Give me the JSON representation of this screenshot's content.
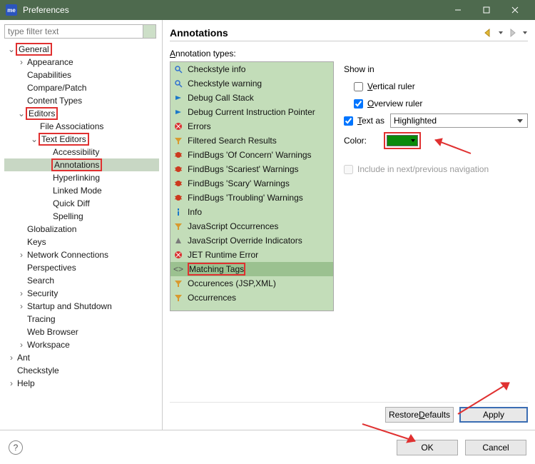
{
  "window": {
    "title": "Preferences",
    "app_icon_text": "me"
  },
  "filter": {
    "placeholder": "type filter text"
  },
  "tree": [
    {
      "label": "General",
      "depth": 0,
      "expanded": true,
      "hasChildren": true,
      "red": true
    },
    {
      "label": "Appearance",
      "depth": 1,
      "hasChildren": true
    },
    {
      "label": "Capabilities",
      "depth": 1
    },
    {
      "label": "Compare/Patch",
      "depth": 1
    },
    {
      "label": "Content Types",
      "depth": 1
    },
    {
      "label": "Editors",
      "depth": 1,
      "expanded": true,
      "hasChildren": true,
      "red": true
    },
    {
      "label": "File Associations",
      "depth": 2
    },
    {
      "label": "Text Editors",
      "depth": 2,
      "expanded": true,
      "hasChildren": true,
      "red": true
    },
    {
      "label": "Accessibility",
      "depth": 3
    },
    {
      "label": "Annotations",
      "depth": 3,
      "selected": true,
      "red": true
    },
    {
      "label": "Hyperlinking",
      "depth": 3
    },
    {
      "label": "Linked Mode",
      "depth": 3
    },
    {
      "label": "Quick Diff",
      "depth": 3
    },
    {
      "label": "Spelling",
      "depth": 3
    },
    {
      "label": "Globalization",
      "depth": 1
    },
    {
      "label": "Keys",
      "depth": 1
    },
    {
      "label": "Network Connections",
      "depth": 1,
      "hasChildren": true
    },
    {
      "label": "Perspectives",
      "depth": 1
    },
    {
      "label": "Search",
      "depth": 1
    },
    {
      "label": "Security",
      "depth": 1,
      "hasChildren": true
    },
    {
      "label": "Startup and Shutdown",
      "depth": 1,
      "hasChildren": true
    },
    {
      "label": "Tracing",
      "depth": 1
    },
    {
      "label": "Web Browser",
      "depth": 1
    },
    {
      "label": "Workspace",
      "depth": 1,
      "hasChildren": true
    },
    {
      "label": "Ant",
      "depth": 0,
      "hasChildren": true
    },
    {
      "label": "Checkstyle",
      "depth": 0
    },
    {
      "label": "Help",
      "depth": 0,
      "hasChildren": true
    }
  ],
  "page": {
    "title": "Annotations",
    "types_label": "Annotation types:",
    "items": [
      {
        "label": "Checkstyle info",
        "icon": "search",
        "color": "#2f6fd0"
      },
      {
        "label": "Checkstyle warning",
        "icon": "search",
        "color": "#2f6fd0"
      },
      {
        "label": "Debug Call Stack",
        "icon": "arrow",
        "color": "#1b78c9"
      },
      {
        "label": "Debug Current Instruction Pointer",
        "icon": "arrow",
        "color": "#1b78c9"
      },
      {
        "label": "Errors",
        "icon": "error",
        "color": "#d82f2f"
      },
      {
        "label": "Filtered Search Results",
        "icon": "filter",
        "color": "#d89a2f"
      },
      {
        "label": "FindBugs 'Of Concern' Warnings",
        "icon": "bug",
        "color": "#cc3a1e"
      },
      {
        "label": "FindBugs 'Scariest' Warnings",
        "icon": "bug",
        "color": "#cc3a1e"
      },
      {
        "label": "FindBugs 'Scary' Warnings",
        "icon": "bug",
        "color": "#cc3a1e"
      },
      {
        "label": "FindBugs 'Troubling' Warnings",
        "icon": "bug",
        "color": "#cc3a1e"
      },
      {
        "label": "Info",
        "icon": "info",
        "color": "#1b78c9"
      },
      {
        "label": "JavaScript Occurrences",
        "icon": "filter",
        "color": "#d89a2f"
      },
      {
        "label": "JavaScript Override Indicators",
        "icon": "tri",
        "color": "#7a7a7a"
      },
      {
        "label": "JET Runtime Error",
        "icon": "error",
        "color": "#d82f2f"
      },
      {
        "label": "Matching Tags",
        "icon": "tags",
        "color": "#555",
        "selected": true,
        "red": true
      },
      {
        "label": "Occurences (JSP,XML)",
        "icon": "filter",
        "color": "#d89a2f"
      },
      {
        "label": "Occurrences",
        "icon": "filter",
        "color": "#d89a2f"
      }
    ],
    "show_in_label": "Show in",
    "vertical_ruler": {
      "label": "Vertical ruler",
      "checked": false,
      "hotkey": "V"
    },
    "overview_ruler": {
      "label": "Overview ruler",
      "checked": true,
      "hotkey": "O"
    },
    "text_as": {
      "label": "Text as",
      "checked": true,
      "value": "Highlighted",
      "hotkey": "T"
    },
    "color": {
      "label": "Color:",
      "value": "#0a8a0a"
    },
    "include_nav": {
      "label": "Include in next/previous navigation",
      "checked": false,
      "disabled": true
    },
    "restore": "Restore Defaults",
    "apply": "Apply"
  },
  "footer": {
    "ok": "OK",
    "cancel": "Cancel"
  }
}
